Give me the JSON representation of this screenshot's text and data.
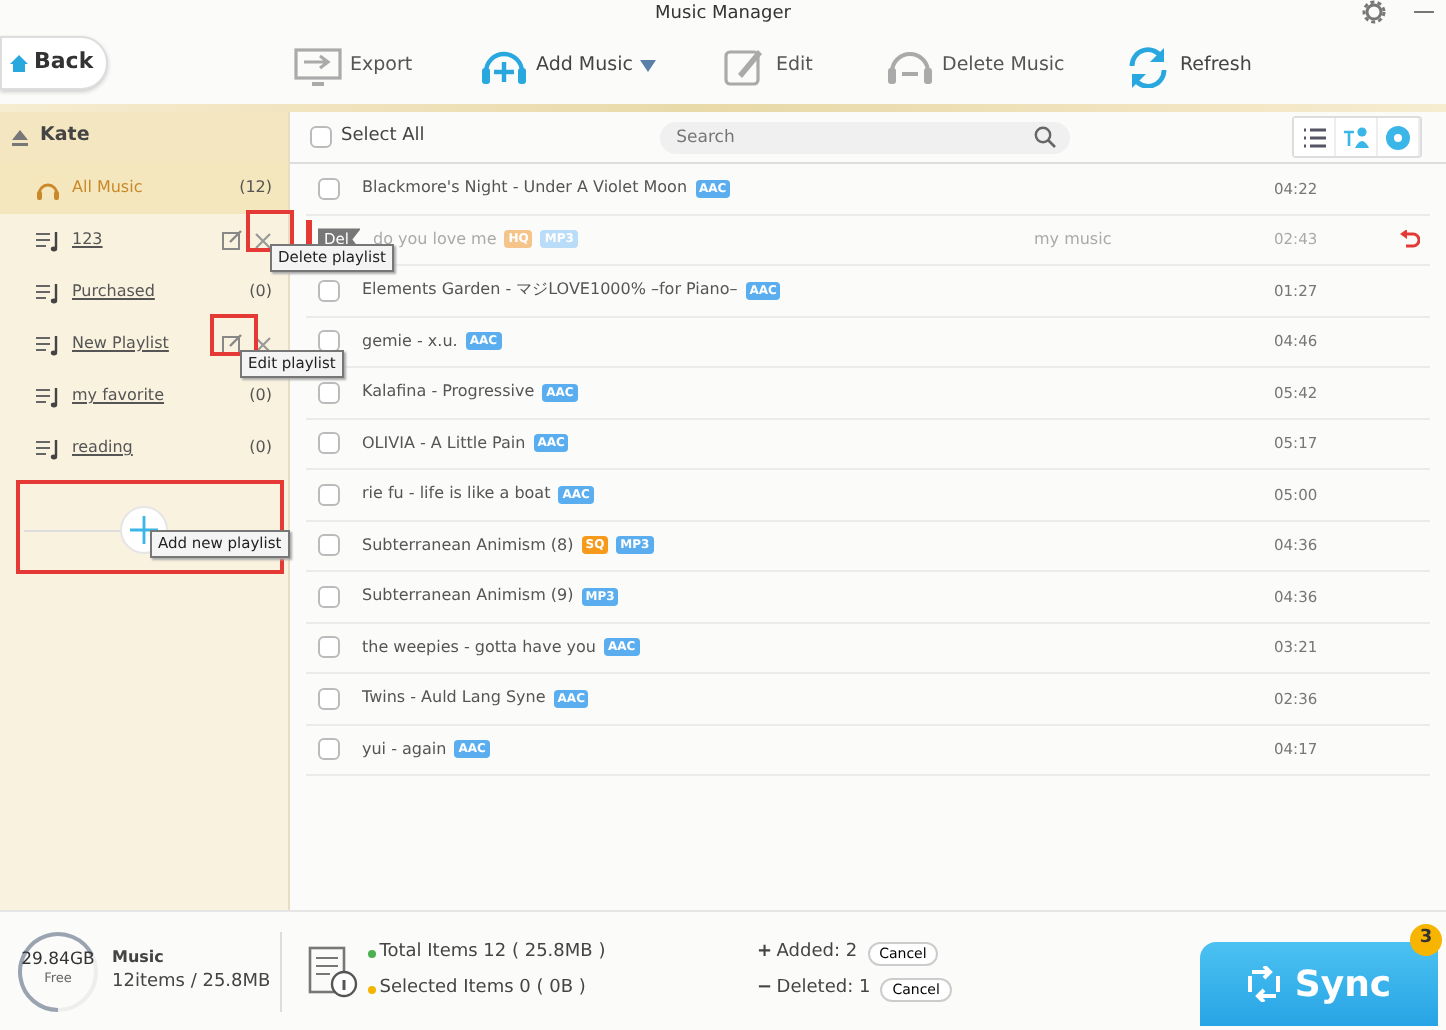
{
  "window": {
    "title": "Music Manager"
  },
  "back_button": "Back",
  "toolbar": [
    {
      "label": "Export",
      "disabled": true,
      "dropdown": false
    },
    {
      "label": "Add Music",
      "disabled": false,
      "dropdown": true
    },
    {
      "label": "Edit",
      "disabled": true,
      "dropdown": false
    },
    {
      "label": "Delete Music",
      "disabled": true,
      "dropdown": false
    },
    {
      "label": "Refresh",
      "disabled": false,
      "dropdown": false
    }
  ],
  "sidebar": {
    "device": "Kate",
    "items": [
      {
        "kind": "library",
        "label": "All Music",
        "count": "(12)",
        "selected": true,
        "edit_icon": false,
        "delete_icon": false
      },
      {
        "kind": "playlist",
        "label": "123",
        "selected": false,
        "edit_icon": true,
        "delete_icon": true
      },
      {
        "kind": "playlist",
        "label": "Purchased",
        "count": "(0)",
        "selected": false,
        "edit_icon": false,
        "delete_icon": false
      },
      {
        "kind": "playlist",
        "label": "New Playlist",
        "selected": false,
        "edit_icon": true,
        "delete_icon": true
      },
      {
        "kind": "playlist",
        "label": "my favorite",
        "count": "(0)",
        "selected": false,
        "edit_icon": false,
        "delete_icon": false
      },
      {
        "kind": "playlist",
        "label": "reading",
        "count": "(0)",
        "selected": false,
        "edit_icon": false,
        "delete_icon": false
      }
    ]
  },
  "tooltips": [
    {
      "text": "Delete playlist"
    },
    {
      "text": "Edit playlist"
    },
    {
      "text": "Add new playlist"
    }
  ],
  "list": {
    "select_all": "Select All",
    "select_all_checked": false,
    "search": {
      "placeholder": "Search"
    },
    "rows": [
      {
        "title": "Blackmore's Night - Under A Violet Moon",
        "badges": [
          {
            "label": "AAC",
            "color": "#5aaef0"
          }
        ],
        "time": "04:22",
        "deleted": false
      },
      {
        "title": "do you love me",
        "badges": [
          {
            "label": "HQ",
            "color": "#f5c48a"
          },
          {
            "label": "MP3",
            "color": "#b9dcf8"
          }
        ],
        "album": "my music",
        "time": "02:43",
        "deleted": true,
        "flag": "Del"
      },
      {
        "title": "Elements Garden - マジLOVE1000% –for Piano–",
        "badges": [
          {
            "label": "AAC",
            "color": "#5aaef0"
          }
        ],
        "time": "01:27",
        "deleted": false
      },
      {
        "title": "gemie - x.u.",
        "badges": [
          {
            "label": "AAC",
            "color": "#5aaef0"
          }
        ],
        "time": "04:46",
        "deleted": false
      },
      {
        "title": "Kalafina - Progressive",
        "badges": [
          {
            "label": "AAC",
            "color": "#5aaef0"
          }
        ],
        "time": "05:42",
        "deleted": false
      },
      {
        "title": "OLIVIA - A Little Pain",
        "badges": [
          {
            "label": "AAC",
            "color": "#5aaef0"
          }
        ],
        "time": "05:17",
        "deleted": false
      },
      {
        "title": "rie fu - life is like a boat",
        "badges": [
          {
            "label": "AAC",
            "color": "#5aaef0"
          }
        ],
        "time": "05:00",
        "deleted": false
      },
      {
        "title": "Subterranean Animism (8)",
        "badges": [
          {
            "label": "SQ",
            "color": "#f59a1b"
          },
          {
            "label": "MP3",
            "color": "#5aaef0"
          }
        ],
        "time": "04:36",
        "deleted": false
      },
      {
        "title": "Subterranean Animism (9)",
        "badges": [
          {
            "label": "MP3",
            "color": "#5aaef0"
          }
        ],
        "time": "04:36",
        "deleted": false
      },
      {
        "title": "the weepies - gotta have you",
        "badges": [
          {
            "label": "AAC",
            "color": "#5aaef0"
          }
        ],
        "time": "03:21",
        "deleted": false
      },
      {
        "title": "Twins - Auld Lang Syne",
        "badges": [
          {
            "label": "AAC",
            "color": "#5aaef0"
          }
        ],
        "time": "02:36",
        "deleted": false
      },
      {
        "title": "yui - again",
        "badges": [
          {
            "label": "AAC",
            "color": "#5aaef0"
          }
        ],
        "time": "04:17",
        "deleted": false
      }
    ]
  },
  "footer": {
    "storage": {
      "free": "29.84GB",
      "free_label": "Free"
    },
    "category": "Music",
    "usage": "12items / 25.8MB",
    "total": "Total Items 12 ( 25.8MB )",
    "selected": "Selected Items 0 ( 0B )",
    "changes": [
      {
        "sign": "+",
        "label": "Added: 2",
        "action": "Cancel"
      },
      {
        "sign": "−",
        "label": "Deleted: 1",
        "action": "Cancel"
      }
    ],
    "sync": {
      "label": "Sync",
      "badge": "3"
    }
  }
}
